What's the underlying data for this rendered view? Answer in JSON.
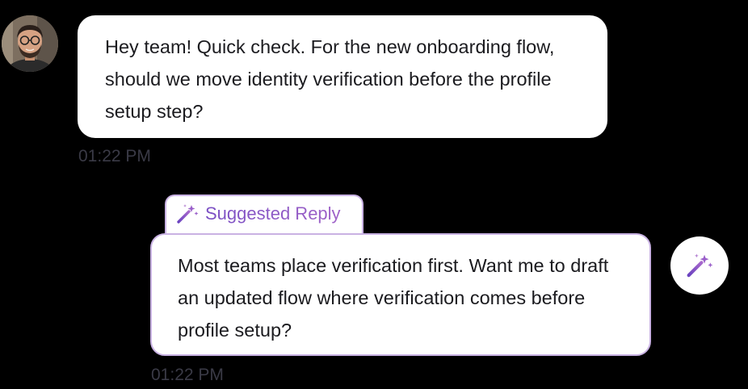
{
  "incoming_message": {
    "text": "Hey team! Quick check. For the new onboarding flow, should we move identity verification before the profile setup step?",
    "time": "01:22 PM",
    "avatar_icon": "user-avatar"
  },
  "suggested_reply": {
    "tab_label": "Suggested Reply",
    "tab_icon": "magic-wand-icon",
    "text": "Most teams place verification first. Want me to draft an updated flow where verification comes before profile setup?",
    "time": "01:22 PM",
    "action_icon": "magic-wand-icon"
  },
  "colors": {
    "background": "#000000",
    "bubble": "#ffffff",
    "accent": "#8557c4",
    "accent_border": "#c9b2e3",
    "timestamp": "#3a3a46"
  }
}
